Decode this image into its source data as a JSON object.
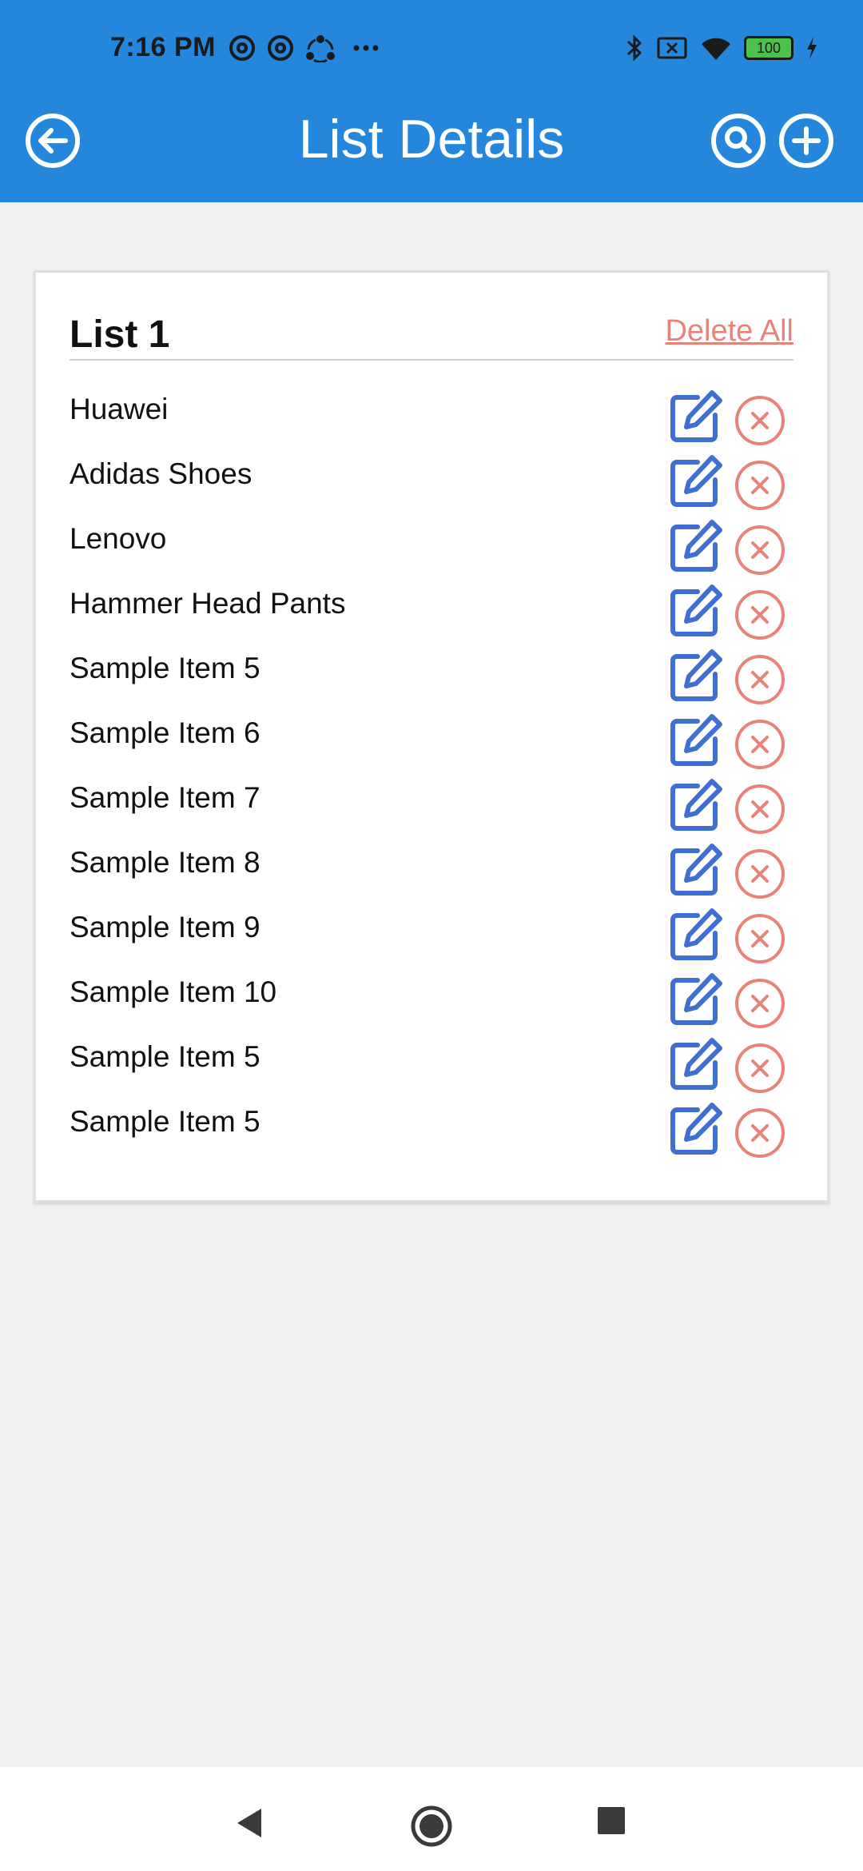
{
  "status_bar": {
    "time": "7:16 PM",
    "battery": "100",
    "icons": [
      "at-sign-icon",
      "at-sign-icon",
      "share-icon",
      "more-dots-icon",
      "bluetooth-icon",
      "sim-icon",
      "wifi-icon",
      "battery-icon",
      "charging-icon"
    ]
  },
  "header": {
    "title": "List Details",
    "back_icon": "back-arrow-icon",
    "search_icon": "search-icon",
    "add_icon": "add-icon"
  },
  "card": {
    "title": "List 1",
    "delete_all_label": "Delete All",
    "items": [
      {
        "label": "Huawei"
      },
      {
        "label": "Adidas Shoes"
      },
      {
        "label": "Lenovo"
      },
      {
        "label": "Hammer Head Pants"
      },
      {
        "label": "Sample Item 5"
      },
      {
        "label": "Sample Item 6"
      },
      {
        "label": "Sample Item 7"
      },
      {
        "label": "Sample Item 8"
      },
      {
        "label": "Sample Item 9"
      },
      {
        "label": "Sample Item 10"
      },
      {
        "label": "Sample Item 5"
      },
      {
        "label": "Sample Item 5"
      }
    ]
  },
  "colors": {
    "primary": "#2487db",
    "edit": "#3f6fd0",
    "delete": "#e8837a"
  },
  "nav_bar": {
    "icons": [
      "nav-back-icon",
      "nav-home-icon",
      "nav-recents-icon"
    ]
  }
}
